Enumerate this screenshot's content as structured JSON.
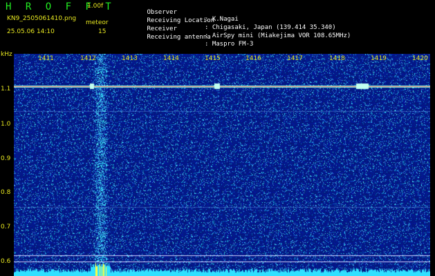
{
  "header": {
    "title": "H R O F F T",
    "version": "1.00f",
    "filename": "KN9_2505061410.png",
    "meteor_label": "meteor",
    "datetime": "25.05.06 14:10",
    "meteor_count": "15"
  },
  "info": {
    "observer_label": "Observer",
    "observer": ": K.Nagai",
    "location_label": "Receiving Location",
    "location": ": Chigasaki, Japan (139.414 35.340)",
    "receiver_label": "Receiver",
    "receiver": ": AirSpy mini (Miakejima VOR 108.65MHz)",
    "antenna_label": "Receiving antenna",
    "antenna": ": Maspro FM-3"
  },
  "axis": {
    "y_unit": "kHz",
    "x_ticks": [
      "1411",
      "1412",
      "1413",
      "1414",
      "1415",
      "1416",
      "1417",
      "1418",
      "1419",
      "1420"
    ],
    "y_ticks": [
      "1.1",
      "1.0",
      "0.9",
      "0.8",
      "0.7",
      "0.6"
    ]
  },
  "colors": {
    "background": "#000000",
    "label_yellow": "#e8e820",
    "title_green": "#22ee22",
    "spectrum_blue": "#0a1f8c"
  }
}
